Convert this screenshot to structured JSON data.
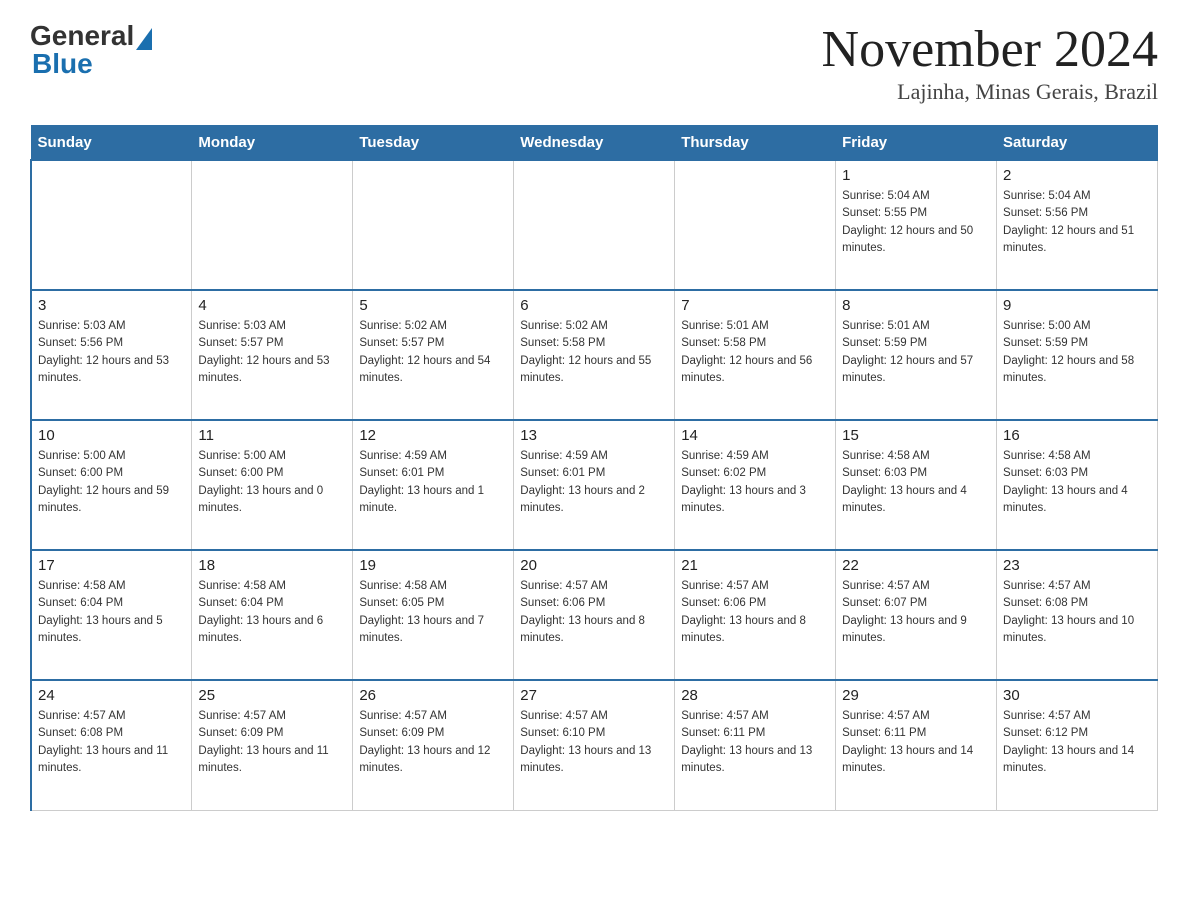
{
  "header": {
    "logo_general": "General",
    "logo_blue": "Blue",
    "month_title": "November 2024",
    "location": "Lajinha, Minas Gerais, Brazil"
  },
  "days_of_week": [
    "Sunday",
    "Monday",
    "Tuesday",
    "Wednesday",
    "Thursday",
    "Friday",
    "Saturday"
  ],
  "weeks": [
    [
      {
        "day": "",
        "sunrise": "",
        "sunset": "",
        "daylight": ""
      },
      {
        "day": "",
        "sunrise": "",
        "sunset": "",
        "daylight": ""
      },
      {
        "day": "",
        "sunrise": "",
        "sunset": "",
        "daylight": ""
      },
      {
        "day": "",
        "sunrise": "",
        "sunset": "",
        "daylight": ""
      },
      {
        "day": "",
        "sunrise": "",
        "sunset": "",
        "daylight": ""
      },
      {
        "day": "1",
        "sunrise": "Sunrise: 5:04 AM",
        "sunset": "Sunset: 5:55 PM",
        "daylight": "Daylight: 12 hours and 50 minutes."
      },
      {
        "day": "2",
        "sunrise": "Sunrise: 5:04 AM",
        "sunset": "Sunset: 5:56 PM",
        "daylight": "Daylight: 12 hours and 51 minutes."
      }
    ],
    [
      {
        "day": "3",
        "sunrise": "Sunrise: 5:03 AM",
        "sunset": "Sunset: 5:56 PM",
        "daylight": "Daylight: 12 hours and 53 minutes."
      },
      {
        "day": "4",
        "sunrise": "Sunrise: 5:03 AM",
        "sunset": "Sunset: 5:57 PM",
        "daylight": "Daylight: 12 hours and 53 minutes."
      },
      {
        "day": "5",
        "sunrise": "Sunrise: 5:02 AM",
        "sunset": "Sunset: 5:57 PM",
        "daylight": "Daylight: 12 hours and 54 minutes."
      },
      {
        "day": "6",
        "sunrise": "Sunrise: 5:02 AM",
        "sunset": "Sunset: 5:58 PM",
        "daylight": "Daylight: 12 hours and 55 minutes."
      },
      {
        "day": "7",
        "sunrise": "Sunrise: 5:01 AM",
        "sunset": "Sunset: 5:58 PM",
        "daylight": "Daylight: 12 hours and 56 minutes."
      },
      {
        "day": "8",
        "sunrise": "Sunrise: 5:01 AM",
        "sunset": "Sunset: 5:59 PM",
        "daylight": "Daylight: 12 hours and 57 minutes."
      },
      {
        "day": "9",
        "sunrise": "Sunrise: 5:00 AM",
        "sunset": "Sunset: 5:59 PM",
        "daylight": "Daylight: 12 hours and 58 minutes."
      }
    ],
    [
      {
        "day": "10",
        "sunrise": "Sunrise: 5:00 AM",
        "sunset": "Sunset: 6:00 PM",
        "daylight": "Daylight: 12 hours and 59 minutes."
      },
      {
        "day": "11",
        "sunrise": "Sunrise: 5:00 AM",
        "sunset": "Sunset: 6:00 PM",
        "daylight": "Daylight: 13 hours and 0 minutes."
      },
      {
        "day": "12",
        "sunrise": "Sunrise: 4:59 AM",
        "sunset": "Sunset: 6:01 PM",
        "daylight": "Daylight: 13 hours and 1 minute."
      },
      {
        "day": "13",
        "sunrise": "Sunrise: 4:59 AM",
        "sunset": "Sunset: 6:01 PM",
        "daylight": "Daylight: 13 hours and 2 minutes."
      },
      {
        "day": "14",
        "sunrise": "Sunrise: 4:59 AM",
        "sunset": "Sunset: 6:02 PM",
        "daylight": "Daylight: 13 hours and 3 minutes."
      },
      {
        "day": "15",
        "sunrise": "Sunrise: 4:58 AM",
        "sunset": "Sunset: 6:03 PM",
        "daylight": "Daylight: 13 hours and 4 minutes."
      },
      {
        "day": "16",
        "sunrise": "Sunrise: 4:58 AM",
        "sunset": "Sunset: 6:03 PM",
        "daylight": "Daylight: 13 hours and 4 minutes."
      }
    ],
    [
      {
        "day": "17",
        "sunrise": "Sunrise: 4:58 AM",
        "sunset": "Sunset: 6:04 PM",
        "daylight": "Daylight: 13 hours and 5 minutes."
      },
      {
        "day": "18",
        "sunrise": "Sunrise: 4:58 AM",
        "sunset": "Sunset: 6:04 PM",
        "daylight": "Daylight: 13 hours and 6 minutes."
      },
      {
        "day": "19",
        "sunrise": "Sunrise: 4:58 AM",
        "sunset": "Sunset: 6:05 PM",
        "daylight": "Daylight: 13 hours and 7 minutes."
      },
      {
        "day": "20",
        "sunrise": "Sunrise: 4:57 AM",
        "sunset": "Sunset: 6:06 PM",
        "daylight": "Daylight: 13 hours and 8 minutes."
      },
      {
        "day": "21",
        "sunrise": "Sunrise: 4:57 AM",
        "sunset": "Sunset: 6:06 PM",
        "daylight": "Daylight: 13 hours and 8 minutes."
      },
      {
        "day": "22",
        "sunrise": "Sunrise: 4:57 AM",
        "sunset": "Sunset: 6:07 PM",
        "daylight": "Daylight: 13 hours and 9 minutes."
      },
      {
        "day": "23",
        "sunrise": "Sunrise: 4:57 AM",
        "sunset": "Sunset: 6:08 PM",
        "daylight": "Daylight: 13 hours and 10 minutes."
      }
    ],
    [
      {
        "day": "24",
        "sunrise": "Sunrise: 4:57 AM",
        "sunset": "Sunset: 6:08 PM",
        "daylight": "Daylight: 13 hours and 11 minutes."
      },
      {
        "day": "25",
        "sunrise": "Sunrise: 4:57 AM",
        "sunset": "Sunset: 6:09 PM",
        "daylight": "Daylight: 13 hours and 11 minutes."
      },
      {
        "day": "26",
        "sunrise": "Sunrise: 4:57 AM",
        "sunset": "Sunset: 6:09 PM",
        "daylight": "Daylight: 13 hours and 12 minutes."
      },
      {
        "day": "27",
        "sunrise": "Sunrise: 4:57 AM",
        "sunset": "Sunset: 6:10 PM",
        "daylight": "Daylight: 13 hours and 13 minutes."
      },
      {
        "day": "28",
        "sunrise": "Sunrise: 4:57 AM",
        "sunset": "Sunset: 6:11 PM",
        "daylight": "Daylight: 13 hours and 13 minutes."
      },
      {
        "day": "29",
        "sunrise": "Sunrise: 4:57 AM",
        "sunset": "Sunset: 6:11 PM",
        "daylight": "Daylight: 13 hours and 14 minutes."
      },
      {
        "day": "30",
        "sunrise": "Sunrise: 4:57 AM",
        "sunset": "Sunset: 6:12 PM",
        "daylight": "Daylight: 13 hours and 14 minutes."
      }
    ]
  ]
}
